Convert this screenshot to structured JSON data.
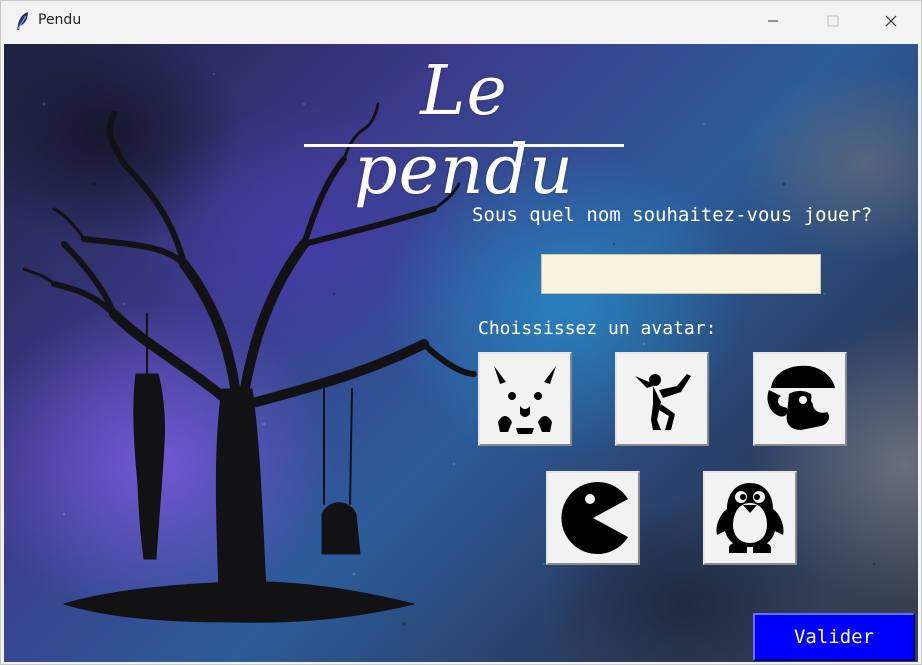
{
  "window": {
    "title": "Pendu",
    "icons": {
      "app": "feather-icon",
      "minimize": "minimize-icon",
      "maximize": "maximize-icon",
      "close": "close-icon"
    }
  },
  "game": {
    "title": "Le pendu",
    "name_prompt": "Sous quel nom souhaitez-vous jouer?",
    "name_input": {
      "value": "",
      "placeholder": ""
    },
    "avatar_prompt": "Choississez un avatar:",
    "avatars": [
      {
        "icon": "pikachu-avatar-icon"
      },
      {
        "icon": "kung-fu-fighter-avatar-icon"
      },
      {
        "icon": "mario-avatar-icon"
      },
      {
        "icon": "pacman-avatar-icon"
      },
      {
        "icon": "penguin-avatar-icon"
      }
    ],
    "submit_label": "Valider",
    "background_illustration": "hanging-tree-illustration"
  },
  "colors": {
    "submit_button": "#0000ff",
    "name_input_bg": "#f7f3dc",
    "text": "#ffffff"
  }
}
